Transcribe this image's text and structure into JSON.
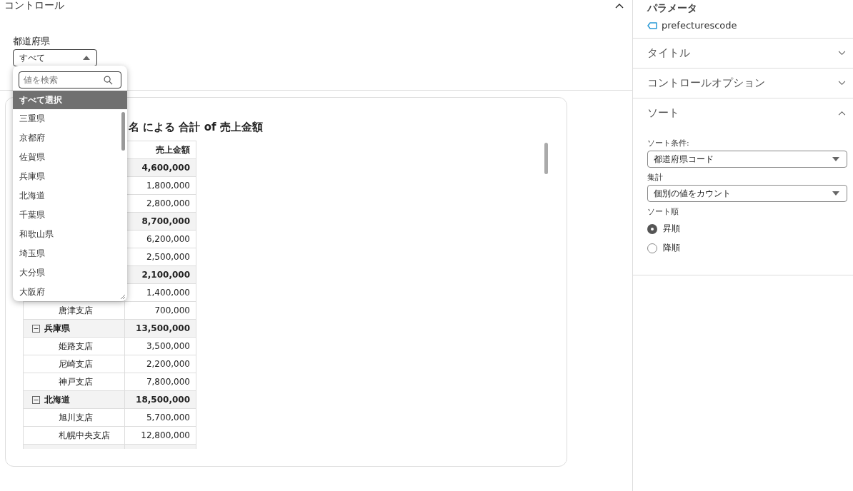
{
  "control_panel": {
    "title": "コントロール",
    "expanded": true,
    "filter": {
      "label": "都道府県",
      "value": "すべて",
      "open": true,
      "search": {
        "placeholder": "値を検索"
      },
      "options": [
        {
          "label": "すべて選択",
          "highlighted": true
        },
        {
          "label": "三重県",
          "highlighted": false
        },
        {
          "label": "京都府",
          "highlighted": false
        },
        {
          "label": "佐賀県",
          "highlighted": false
        },
        {
          "label": "兵庫県",
          "highlighted": false
        },
        {
          "label": "北海道",
          "highlighted": false
        },
        {
          "label": "千葉県",
          "highlighted": false
        },
        {
          "label": "和歌山県",
          "highlighted": false
        },
        {
          "label": "埼玉県",
          "highlighted": false
        },
        {
          "label": "大分県",
          "highlighted": false
        },
        {
          "label": "大阪府",
          "highlighted": false
        }
      ]
    }
  },
  "pivot": {
    "title": "名 による 合計 of 売上金額",
    "columns": [
      "売上金額"
    ],
    "rows": [
      {
        "kind": "group",
        "value": "4,600,000"
      },
      {
        "kind": "item",
        "value": "1,800,000"
      },
      {
        "kind": "item",
        "value": "2,800,000"
      },
      {
        "kind": "group",
        "value": "8,700,000"
      },
      {
        "kind": "item",
        "value": "6,200,000"
      },
      {
        "kind": "item",
        "value": "2,500,000"
      },
      {
        "kind": "group",
        "value": "2,100,000"
      },
      {
        "kind": "item",
        "value": "1,400,000"
      },
      {
        "kind": "item",
        "label": "唐津支店",
        "value": "700,000"
      },
      {
        "kind": "group",
        "label": "兵庫県",
        "value": "13,500,000"
      },
      {
        "kind": "item",
        "label": "姫路支店",
        "value": "3,500,000"
      },
      {
        "kind": "item",
        "label": "尼崎支店",
        "value": "2,200,000"
      },
      {
        "kind": "item",
        "label": "神戸支店",
        "value": "7,800,000"
      },
      {
        "kind": "group",
        "label": "北海道",
        "value": "18,500,000"
      },
      {
        "kind": "item",
        "label": "旭川支店",
        "value": "5,700,000"
      },
      {
        "kind": "item",
        "label": "札幌中央支店",
        "value": "12,800,000"
      },
      {
        "kind": "group"
      }
    ]
  },
  "side_panel": {
    "parameter": {
      "heading": "パラメータ",
      "name": "prefecturescode"
    },
    "sections": [
      {
        "title": "タイトル",
        "expanded": false
      },
      {
        "title": "コントロールオプション",
        "expanded": false
      },
      {
        "title": "ソート",
        "expanded": true,
        "fields": [
          {
            "label": "ソート条件:",
            "value": "都道府県コード"
          },
          {
            "label": "集計",
            "value": "個別の値をカウント"
          }
        ],
        "order": {
          "label": "ソート順",
          "options": [
            {
              "label": "昇順",
              "selected": true
            },
            {
              "label": "降順",
              "selected": false
            }
          ]
        }
      }
    ]
  }
}
